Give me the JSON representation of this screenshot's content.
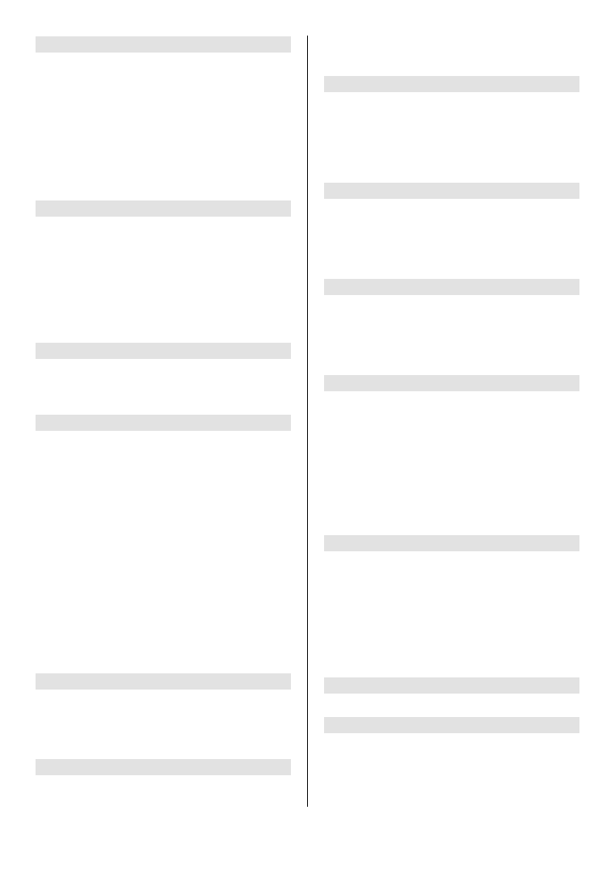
{
  "page": {
    "background_color": "#ffffff",
    "heading_bar_color": "#e2e2e2",
    "divider_color": "#000000"
  },
  "left_column": {
    "section_headers": [
      {
        "label": ""
      },
      {
        "label": ""
      },
      {
        "label": ""
      },
      {
        "label": ""
      },
      {
        "label": ""
      },
      {
        "label": ""
      }
    ]
  },
  "right_column": {
    "section_headers": [
      {
        "label": ""
      },
      {
        "label": ""
      },
      {
        "label": ""
      },
      {
        "label": ""
      },
      {
        "label": ""
      },
      {
        "label": ""
      },
      {
        "label": ""
      }
    ]
  }
}
